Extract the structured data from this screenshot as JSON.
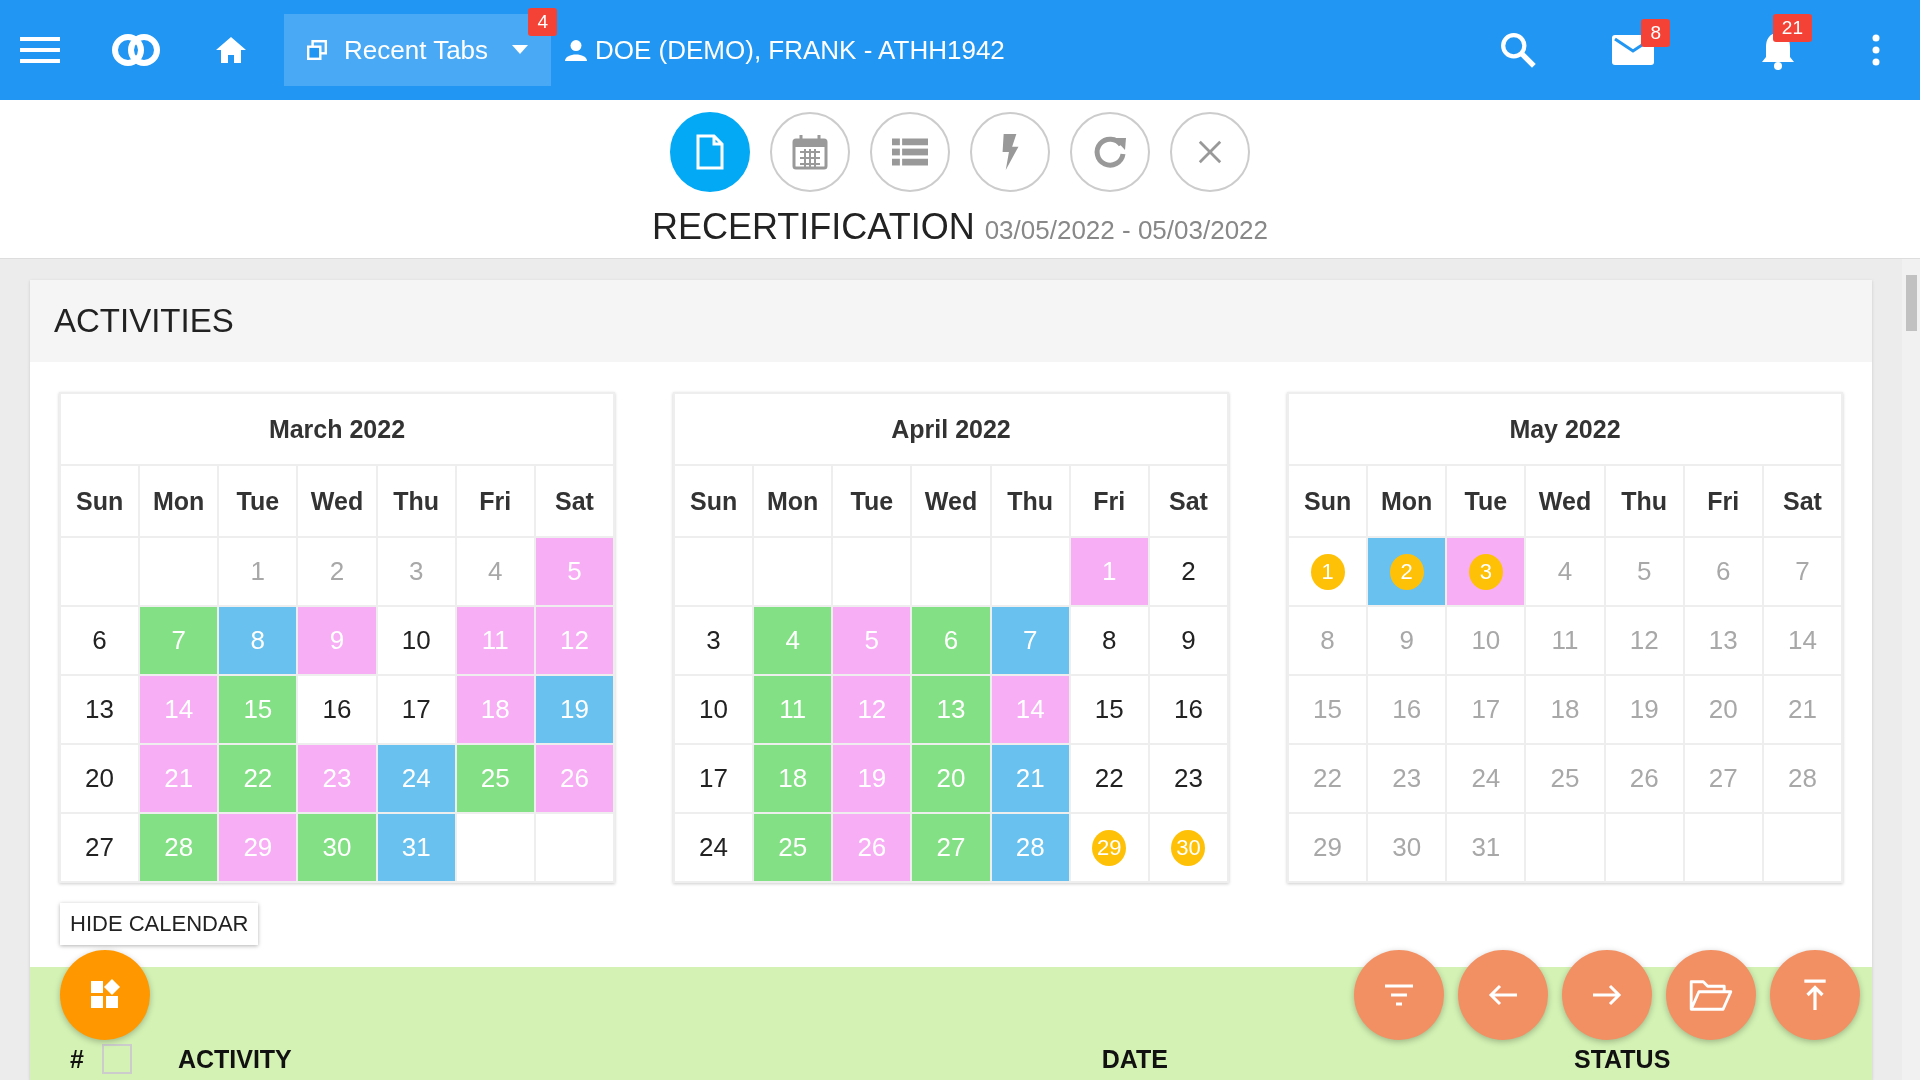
{
  "topbar": {
    "recent_tabs": {
      "label": "Recent Tabs",
      "badge": "4"
    },
    "user": "DOE (DEMO), FRANK - ATHH1942",
    "mail_badge": "8",
    "notifications_badge": "21"
  },
  "toolbar": {
    "buttons": [
      {
        "kind": "document",
        "selected": true
      },
      {
        "kind": "calendar",
        "selected": false
      },
      {
        "kind": "list",
        "selected": false
      },
      {
        "kind": "bolt",
        "selected": false
      },
      {
        "kind": "refresh",
        "selected": false
      },
      {
        "kind": "close",
        "selected": false
      }
    ]
  },
  "page_title": {
    "title": "RECERTIFICATION",
    "dates": "03/05/2022 - 05/03/2022"
  },
  "section_title": "ACTIVITIES",
  "months": [
    {
      "title": "March 2022",
      "weekdays": [
        "Sun",
        "Mon",
        "Tue",
        "Wed",
        "Thu",
        "Fri",
        "Sat"
      ],
      "weeks": [
        [
          {
            "kind": "blank"
          },
          {
            "kind": "blank"
          },
          {
            "day": "1",
            "kind": "faded"
          },
          {
            "day": "2",
            "kind": "faded"
          },
          {
            "day": "3",
            "kind": "faded"
          },
          {
            "day": "4",
            "kind": "faded"
          },
          {
            "day": "5",
            "kind": "activity",
            "color": "#f7aef5"
          }
        ],
        [
          {
            "day": "6",
            "kind": "plain"
          },
          {
            "day": "7",
            "kind": "activity",
            "color": "#84e084"
          },
          {
            "day": "8",
            "kind": "activity",
            "color": "#68c1ef"
          },
          {
            "day": "9",
            "kind": "activity",
            "color": "#f7aef5"
          },
          {
            "day": "10",
            "kind": "plain"
          },
          {
            "day": "11",
            "kind": "activity",
            "color": "#f7aef5"
          },
          {
            "day": "12",
            "kind": "activity",
            "color": "#f7aef5"
          }
        ],
        [
          {
            "day": "13",
            "kind": "plain"
          },
          {
            "day": "14",
            "kind": "activity",
            "color": "#f7aef5"
          },
          {
            "day": "15",
            "kind": "activity",
            "color": "#84e084"
          },
          {
            "day": "16",
            "kind": "plain"
          },
          {
            "day": "17",
            "kind": "plain"
          },
          {
            "day": "18",
            "kind": "activity",
            "color": "#f7aef5"
          },
          {
            "day": "19",
            "kind": "activity",
            "color": "#68c1ef"
          }
        ],
        [
          {
            "day": "20",
            "kind": "plain"
          },
          {
            "day": "21",
            "kind": "activity",
            "color": "#f7aef5"
          },
          {
            "day": "22",
            "kind": "activity",
            "color": "#84e084"
          },
          {
            "day": "23",
            "kind": "activity",
            "color": "#f7aef5"
          },
          {
            "day": "24",
            "kind": "activity",
            "color": "#68c1ef"
          },
          {
            "day": "25",
            "kind": "activity",
            "color": "#84e084"
          },
          {
            "day": "26",
            "kind": "activity",
            "color": "#f7aef5"
          }
        ],
        [
          {
            "day": "27",
            "kind": "plain"
          },
          {
            "day": "28",
            "kind": "activity",
            "color": "#84e084"
          },
          {
            "day": "29",
            "kind": "activity",
            "color": "#f7aef5"
          },
          {
            "day": "30",
            "kind": "activity",
            "color": "#84e084"
          },
          {
            "day": "31",
            "kind": "activity",
            "color": "#68c1ef"
          },
          {
            "kind": "blank"
          },
          {
            "kind": "blank"
          }
        ]
      ]
    },
    {
      "title": "April 2022",
      "weekdays": [
        "Sun",
        "Mon",
        "Tue",
        "Wed",
        "Thu",
        "Fri",
        "Sat"
      ],
      "weeks": [
        [
          {
            "kind": "blank"
          },
          {
            "kind": "blank"
          },
          {
            "kind": "blank"
          },
          {
            "kind": "blank"
          },
          {
            "kind": "blank"
          },
          {
            "day": "1",
            "kind": "activity",
            "color": "#f7aef5"
          },
          {
            "day": "2",
            "kind": "plain"
          }
        ],
        [
          {
            "day": "3",
            "kind": "plain"
          },
          {
            "day": "4",
            "kind": "activity",
            "color": "#84e084"
          },
          {
            "day": "5",
            "kind": "activity",
            "color": "#f7aef5"
          },
          {
            "day": "6",
            "kind": "activity",
            "color": "#84e084"
          },
          {
            "day": "7",
            "kind": "activity",
            "color": "#68c1ef"
          },
          {
            "day": "8",
            "kind": "plain"
          },
          {
            "day": "9",
            "kind": "plain"
          }
        ],
        [
          {
            "day": "10",
            "kind": "plain"
          },
          {
            "day": "11",
            "kind": "activity",
            "color": "#84e084"
          },
          {
            "day": "12",
            "kind": "activity",
            "color": "#f7aef5"
          },
          {
            "day": "13",
            "kind": "activity",
            "color": "#84e084"
          },
          {
            "day": "14",
            "kind": "activity",
            "color": "#f7aef5"
          },
          {
            "day": "15",
            "kind": "plain"
          },
          {
            "day": "16",
            "kind": "plain"
          }
        ],
        [
          {
            "day": "17",
            "kind": "plain"
          },
          {
            "day": "18",
            "kind": "activity",
            "color": "#84e084"
          },
          {
            "day": "19",
            "kind": "activity",
            "color": "#f7aef5"
          },
          {
            "day": "20",
            "kind": "activity",
            "color": "#84e084"
          },
          {
            "day": "21",
            "kind": "activity",
            "color": "#68c1ef"
          },
          {
            "day": "22",
            "kind": "plain"
          },
          {
            "day": "23",
            "kind": "plain"
          }
        ],
        [
          {
            "day": "24",
            "kind": "plain"
          },
          {
            "day": "25",
            "kind": "activity",
            "color": "#84e084"
          },
          {
            "day": "26",
            "kind": "activity",
            "color": "#f7aef5"
          },
          {
            "day": "27",
            "kind": "activity",
            "color": "#84e084"
          },
          {
            "day": "28",
            "kind": "activity",
            "color": "#68c1ef"
          },
          {
            "day": "29",
            "kind": "circled"
          },
          {
            "day": "30",
            "kind": "circled"
          }
        ]
      ]
    },
    {
      "title": "May 2022",
      "weekdays": [
        "Sun",
        "Mon",
        "Tue",
        "Wed",
        "Thu",
        "Fri",
        "Sat"
      ],
      "weeks": [
        [
          {
            "day": "1",
            "kind": "circled"
          },
          {
            "day": "2",
            "kind": "circled",
            "color": "#68c1ef"
          },
          {
            "day": "3",
            "kind": "circled",
            "color": "#f7aef5"
          },
          {
            "day": "4",
            "kind": "faded"
          },
          {
            "day": "5",
            "kind": "faded"
          },
          {
            "day": "6",
            "kind": "faded"
          },
          {
            "day": "7",
            "kind": "faded"
          }
        ],
        [
          {
            "day": "8",
            "kind": "faded"
          },
          {
            "day": "9",
            "kind": "faded"
          },
          {
            "day": "10",
            "kind": "faded"
          },
          {
            "day": "11",
            "kind": "faded"
          },
          {
            "day": "12",
            "kind": "faded"
          },
          {
            "day": "13",
            "kind": "faded"
          },
          {
            "day": "14",
            "kind": "faded"
          }
        ],
        [
          {
            "day": "15",
            "kind": "faded"
          },
          {
            "day": "16",
            "kind": "faded"
          },
          {
            "day": "17",
            "kind": "faded"
          },
          {
            "day": "18",
            "kind": "faded"
          },
          {
            "day": "19",
            "kind": "faded"
          },
          {
            "day": "20",
            "kind": "faded"
          },
          {
            "day": "21",
            "kind": "faded"
          }
        ],
        [
          {
            "day": "22",
            "kind": "faded"
          },
          {
            "day": "23",
            "kind": "faded"
          },
          {
            "day": "24",
            "kind": "faded"
          },
          {
            "day": "25",
            "kind": "faded"
          },
          {
            "day": "26",
            "kind": "faded"
          },
          {
            "day": "27",
            "kind": "faded"
          },
          {
            "day": "28",
            "kind": "faded"
          }
        ],
        [
          {
            "day": "29",
            "kind": "faded"
          },
          {
            "day": "30",
            "kind": "faded"
          },
          {
            "day": "31",
            "kind": "faded"
          },
          {
            "kind": "blank"
          },
          {
            "kind": "blank"
          },
          {
            "kind": "blank"
          },
          {
            "kind": "blank"
          }
        ]
      ]
    }
  ],
  "hide_calendar": "HIDE CALENDAR",
  "table": {
    "columns": [
      "#",
      "ACTIVITY",
      "DATE",
      "STATUS"
    ],
    "select_all": {
      "checked": false
    }
  },
  "fabs": [
    {
      "kind": "widgets"
    },
    {
      "kind": "filter"
    },
    {
      "kind": "back"
    },
    {
      "kind": "forward"
    },
    {
      "kind": "folder"
    },
    {
      "kind": "top"
    }
  ]
}
